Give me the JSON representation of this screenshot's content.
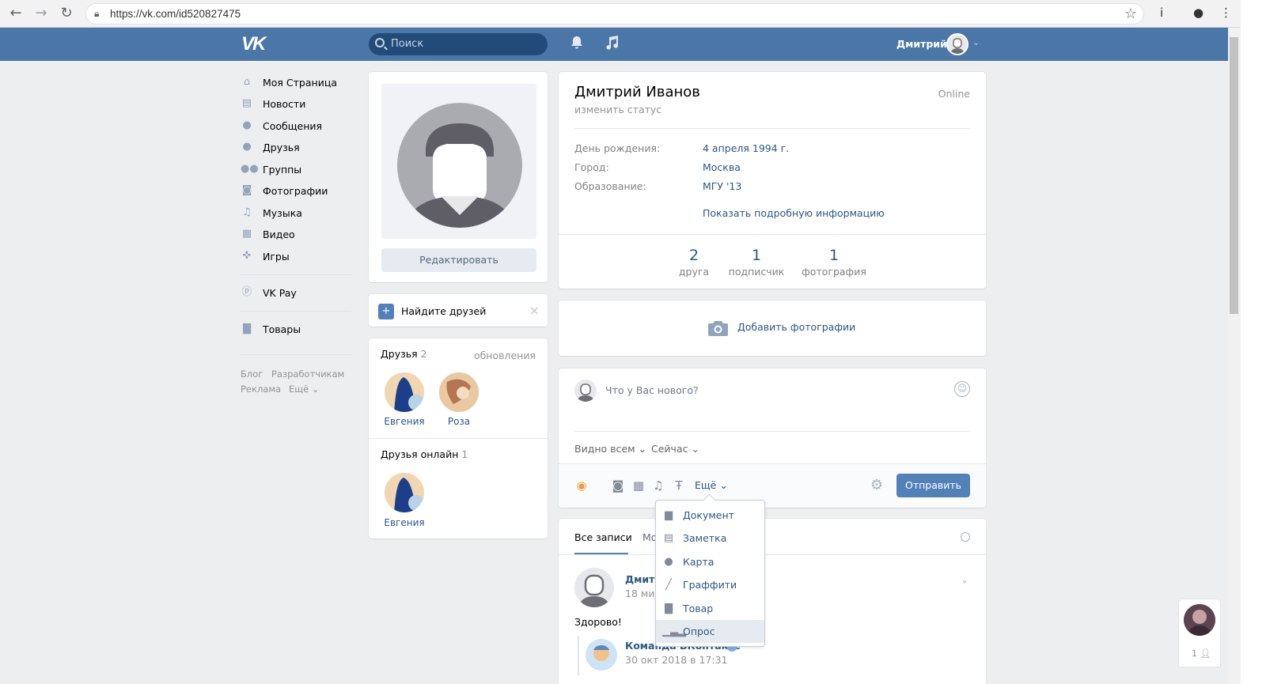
{
  "browser": {
    "url": "https://vk.com/id520827475"
  },
  "header": {
    "logo": "VK",
    "search_placeholder": "Поиск",
    "username": "Дмитрий"
  },
  "menu": {
    "items": [
      {
        "label": "Моя Страница",
        "icon": "home-icon"
      },
      {
        "label": "Новости",
        "icon": "news-icon"
      },
      {
        "label": "Сообщения",
        "icon": "messages-icon"
      },
      {
        "label": "Друзья",
        "icon": "friends-icon"
      },
      {
        "label": "Группы",
        "icon": "groups-icon"
      },
      {
        "label": "Фотографии",
        "icon": "camera-icon"
      },
      {
        "label": "Музыка",
        "icon": "music-icon"
      },
      {
        "label": "Видео",
        "icon": "video-icon"
      },
      {
        "label": "Игры",
        "icon": "games-icon"
      }
    ],
    "vkpay": "VK Pay",
    "goods": "Товары",
    "footer": [
      "Блог",
      "Разработчикам",
      "Реклама",
      "Ещё"
    ]
  },
  "profile": {
    "edit_button": "Редактировать",
    "find_friends": "Найдите друзей",
    "friends_title": "Друзья",
    "friends_count": "2",
    "friends_updates": "обновления",
    "friends": [
      "Евгения",
      "Роза"
    ],
    "friends_online_title": "Друзья онлайн",
    "friends_online_count": "1",
    "friends_online": [
      "Евгения"
    ]
  },
  "info": {
    "name": "Дмитрий Иванов",
    "status": "изменить статус",
    "online": "Online",
    "rows": [
      {
        "label": "День рождения:",
        "value": "4 апреля 1994 г."
      },
      {
        "label": "Город:",
        "value": "Москва"
      },
      {
        "label": "Образование:",
        "value": "МГУ '13"
      }
    ],
    "show_more": "Показать подробную информацию",
    "counters": [
      {
        "num": "2",
        "label": "друга"
      },
      {
        "num": "1",
        "label": "подписчик"
      },
      {
        "num": "1",
        "label": "фотография"
      }
    ]
  },
  "photos": {
    "add_label": "Добавить фотографии"
  },
  "composer": {
    "placeholder": "Что у Вас нового?",
    "visibility": "Видно всем",
    "time": "Сейчас",
    "more": "Ещё",
    "send": "Отправить"
  },
  "dropdown": {
    "items": [
      {
        "label": "Документ",
        "icon": "document-icon"
      },
      {
        "label": "Заметка",
        "icon": "note-icon"
      },
      {
        "label": "Карта",
        "icon": "map-pin-icon"
      },
      {
        "label": "Граффити",
        "icon": "brush-icon"
      },
      {
        "label": "Товар",
        "icon": "bag-icon"
      },
      {
        "label": "Опрос",
        "icon": "poll-icon"
      }
    ]
  },
  "wall": {
    "tab_all": "Все записи",
    "tab_mine": "Мо",
    "post_author": "Дмитр",
    "post_time": "18 мин",
    "post_text": "Здорово!",
    "repost_author": "Команда ВКонтакте",
    "repost_time": "30 окт 2018 в 17:31"
  },
  "chat": {
    "count": "1"
  }
}
